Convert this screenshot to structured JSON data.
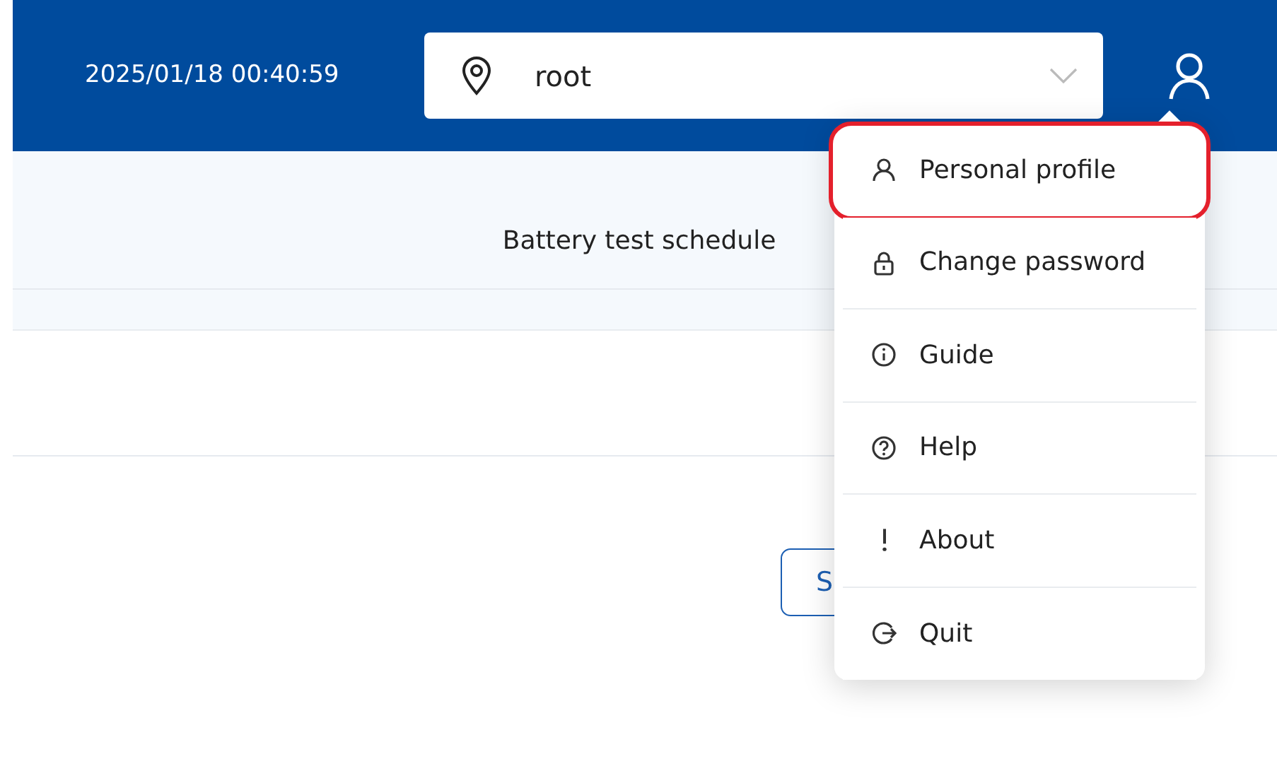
{
  "header": {
    "datetime": "2025/01/18 00:40:59",
    "location_select": {
      "value": "root"
    }
  },
  "page_title": "Battery test schedule",
  "content": {
    "button": {
      "label": "S"
    }
  },
  "user_menu": {
    "items": [
      {
        "label": "Personal profile",
        "highlighted": true
      },
      {
        "label": "Change password",
        "highlighted": false
      },
      {
        "label": "Guide",
        "highlighted": false
      },
      {
        "label": "Help",
        "highlighted": false
      },
      {
        "label": "About",
        "highlighted": false
      },
      {
        "label": "Quit",
        "highlighted": false
      }
    ]
  }
}
